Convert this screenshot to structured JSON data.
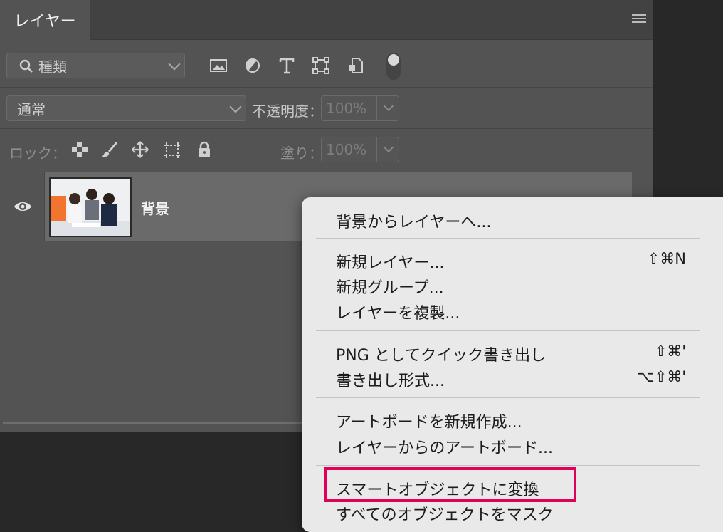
{
  "panel": {
    "tab_label": "レイヤー",
    "filter": {
      "label": "種類"
    },
    "blend_mode": "通常",
    "opacity": {
      "label": "不透明度：",
      "value": "100%"
    },
    "lock": {
      "label": "ロック："
    },
    "fill": {
      "label": "塗り：",
      "value": "100%"
    },
    "layers": [
      {
        "name": "背景",
        "visible": true
      }
    ],
    "filter_icons": [
      "image-icon",
      "adjustment-icon",
      "type-icon",
      "shape-icon",
      "smart-object-icon"
    ],
    "lock_icons": [
      "lock-transparency-icon",
      "lock-paint-icon",
      "lock-position-icon",
      "lock-artboard-icon",
      "lock-all-icon"
    ]
  },
  "context_menu": {
    "items": [
      {
        "label": "背景からレイヤーへ...",
        "shortcut": ""
      },
      {
        "label": "新規レイヤー...",
        "shortcut": "⇧⌘N"
      },
      {
        "label": "新規グループ...",
        "shortcut": ""
      },
      {
        "label": "レイヤーを複製...",
        "shortcut": ""
      },
      {
        "label": "PNG としてクイック書き出し",
        "shortcut": "⇧⌘'"
      },
      {
        "label": "書き出し形式...",
        "shortcut": "⌥⇧⌘'"
      },
      {
        "label": "アートボードを新規作成...",
        "shortcut": ""
      },
      {
        "label": "レイヤーからのアートボード...",
        "shortcut": ""
      },
      {
        "label": "スマートオブジェクトに変換",
        "shortcut": "",
        "highlighted": true
      },
      {
        "label": "すべてのオブジェクトをマスク",
        "shortcut": ""
      }
    ]
  },
  "colors": {
    "highlight": "#e0005a",
    "panel_bg": "#535353",
    "menu_bg": "#e9e9e9"
  }
}
